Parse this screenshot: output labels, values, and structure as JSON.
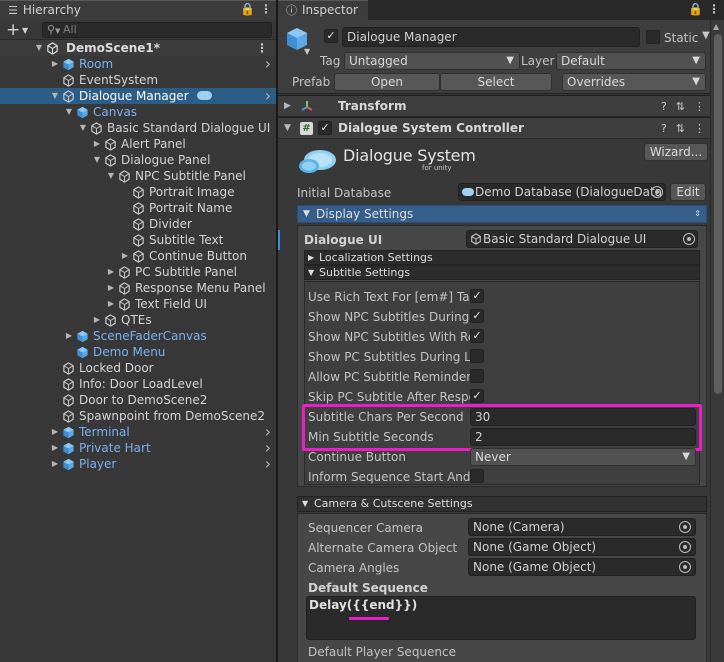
{
  "hierarchy": {
    "tab_label": "Hierarchy",
    "search_placeholder": "All",
    "scene_name": "DemoScene1*",
    "items": [
      {
        "label": "Room",
        "indent": 1,
        "color": "blue",
        "fold": "closed",
        "arrow": true
      },
      {
        "label": "EventSystem",
        "indent": 1,
        "color": "white",
        "fold": "none",
        "arrow": false
      },
      {
        "label": "Dialogue Manager",
        "indent": 1,
        "color": "white",
        "fold": "open",
        "arrow": true,
        "selected": true,
        "badge": true
      },
      {
        "label": "Canvas",
        "indent": 2,
        "color": "blue",
        "fold": "open",
        "arrow": false
      },
      {
        "label": "Basic Standard Dialogue UI",
        "indent": 3,
        "color": "white",
        "fold": "open",
        "arrow": false
      },
      {
        "label": "Alert Panel",
        "indent": 4,
        "color": "white",
        "fold": "closed",
        "arrow": false
      },
      {
        "label": "Dialogue Panel",
        "indent": 4,
        "color": "white",
        "fold": "open",
        "arrow": false
      },
      {
        "label": "NPC Subtitle Panel",
        "indent": 5,
        "color": "white",
        "fold": "open",
        "arrow": false
      },
      {
        "label": "Portrait Image",
        "indent": 6,
        "color": "white",
        "fold": "none",
        "arrow": false
      },
      {
        "label": "Portrait Name",
        "indent": 6,
        "color": "white",
        "fold": "none",
        "arrow": false
      },
      {
        "label": "Divider",
        "indent": 6,
        "color": "white",
        "fold": "none",
        "arrow": false
      },
      {
        "label": "Subtitle Text",
        "indent": 6,
        "color": "white",
        "fold": "none",
        "arrow": false
      },
      {
        "label": "Continue Button",
        "indent": 6,
        "color": "white",
        "fold": "closed",
        "arrow": false
      },
      {
        "label": "PC Subtitle Panel",
        "indent": 5,
        "color": "white",
        "fold": "closed",
        "arrow": false
      },
      {
        "label": "Response Menu Panel",
        "indent": 5,
        "color": "white",
        "fold": "closed",
        "arrow": false
      },
      {
        "label": "Text Field UI",
        "indent": 5,
        "color": "white",
        "fold": "closed",
        "arrow": false
      },
      {
        "label": "QTEs",
        "indent": 4,
        "color": "white",
        "fold": "closed",
        "arrow": false
      },
      {
        "label": "SceneFaderCanvas",
        "indent": 2,
        "color": "blue",
        "fold": "closed",
        "arrow": false
      },
      {
        "label": "Demo Menu",
        "indent": 2,
        "color": "blue",
        "fold": "none",
        "arrow": false
      },
      {
        "label": "Locked Door",
        "indent": 1,
        "color": "white",
        "fold": "none",
        "arrow": false
      },
      {
        "label": "Info: Door LoadLevel",
        "indent": 1,
        "color": "white",
        "fold": "none",
        "arrow": false
      },
      {
        "label": "Door to DemoScene2",
        "indent": 1,
        "color": "white",
        "fold": "none",
        "arrow": false
      },
      {
        "label": "Spawnpoint from DemoScene2",
        "indent": 1,
        "color": "white",
        "fold": "none",
        "arrow": false
      },
      {
        "label": "Terminal",
        "indent": 1,
        "color": "blue",
        "fold": "closed",
        "arrow": true
      },
      {
        "label": "Private Hart",
        "indent": 1,
        "color": "blue",
        "fold": "closed",
        "arrow": true
      },
      {
        "label": "Player",
        "indent": 1,
        "color": "blue",
        "fold": "closed",
        "arrow": true
      }
    ]
  },
  "inspector": {
    "tab_label": "Inspector",
    "object_name": "Dialogue Manager",
    "static_label": "Static",
    "tag_label": "Tag",
    "tag_value": "Untagged",
    "layer_label": "Layer",
    "layer_value": "Default",
    "prefab_label": "Prefab",
    "prefab_open": "Open",
    "prefab_select": "Select",
    "prefab_overrides": "Overrides",
    "transform_title": "Transform",
    "controller_title": "Dialogue System Controller",
    "logo_text": "Dialogue System",
    "logo_sub": "for unity",
    "wizard_button": "Wizard...",
    "initial_db_label": "Initial Database",
    "initial_db_value": "Demo Database (DialogueData",
    "edit_button": "Edit",
    "display_settings": "Display Settings",
    "dialogue_ui_label": "Dialogue UI",
    "dialogue_ui_value": "Basic Standard Dialogue UI",
    "localization_settings": "Localization Settings",
    "subtitle_settings": "Subtitle Settings",
    "subtitle_fields": [
      {
        "label": "Use Rich Text For [em#] Tag",
        "type": "check",
        "checked": true
      },
      {
        "label": "Show NPC Subtitles During L",
        "type": "check",
        "checked": true
      },
      {
        "label": "Show NPC Subtitles With Re",
        "type": "check",
        "checked": true
      },
      {
        "label": "Show PC Subtitles During Lin",
        "type": "check",
        "checked": false
      },
      {
        "label": "Allow PC Subtitle Reminders",
        "type": "check",
        "checked": false
      },
      {
        "label": "Skip PC Subtitle After Respo",
        "type": "check",
        "checked": true
      },
      {
        "label": "Subtitle Chars Per Second",
        "type": "text",
        "value": "30"
      },
      {
        "label": "Min Subtitle Seconds",
        "type": "text",
        "value": "2"
      },
      {
        "label": "Continue Button",
        "type": "dropdown",
        "value": "Never"
      },
      {
        "label": "Inform Sequence Start And E",
        "type": "check",
        "checked": false
      }
    ],
    "camera_settings": "Camera & Cutscene Settings",
    "camera_fields": [
      {
        "label": "Sequencer Camera",
        "value": "None (Camera)"
      },
      {
        "label": "Alternate Camera Object",
        "value": "None (Game Object)"
      },
      {
        "label": "Camera Angles",
        "value": "None (Game Object)"
      }
    ],
    "default_sequence_label": "Default Sequence",
    "default_sequence_value": "Delay({{end}})",
    "default_player_sequence_label": "Default Player Sequence"
  },
  "colors": {
    "highlight": "#ea1fc8",
    "selection": "#2c5d87",
    "prefab_blue": "#7bb0f0"
  }
}
